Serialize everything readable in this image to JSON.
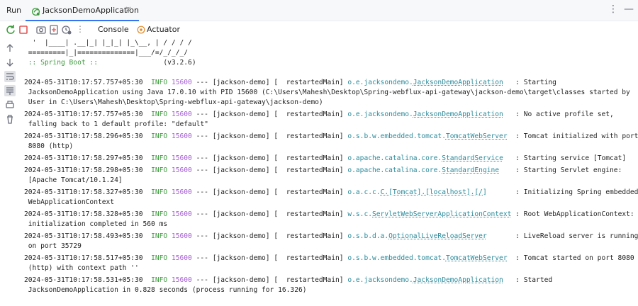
{
  "topbar": {
    "run_label": "Run",
    "tab_label": "JacksonDemoApplication",
    "close": "×",
    "more": "⋮",
    "minimize": "—"
  },
  "toolbar": {
    "separator": "⋮",
    "console_label": "Console",
    "actuator_label": "Actuator"
  },
  "console": {
    "banner_line1": "  '  |____| .__|_| |_|_| |_\\__, | / / / /",
    "banner_line2": " =========|_|==============|___/=/_/_/_/",
    "spring_boot_label": " :: Spring Boot ::",
    "spring_boot_version": "                (v3.2.6)",
    "logs": [
      {
        "ts": "2024-05-31T10:17:57.757+05:30",
        "level": "INFO",
        "pid": "15600",
        "thread": " --- [jackson-demo] [  restartedMain] ",
        "logger_pre": "o.e.jacksondemo.",
        "logger_ul": "JacksonDemoApplication",
        "msg": "   : Starting",
        "cont": [
          " JacksonDemoApplication using Java 17.0.10 with PID 15600 (C:\\Users\\Mahesh\\Desktop\\Spring-webflux-api-gateway\\jackson-demo\\target\\classes started by",
          " User in C:\\Users\\Mahesh\\Desktop\\Spring-webflux-api-gateway\\jackson-demo)"
        ]
      },
      {
        "ts": "2024-05-31T10:17:57.757+05:30",
        "level": "INFO",
        "pid": "15600",
        "thread": " --- [jackson-demo] [  restartedMain] ",
        "logger_pre": "o.e.jacksondemo.",
        "logger_ul": "JacksonDemoApplication",
        "msg": "   : No active profile set,",
        "cont": [
          " falling back to 1 default profile: \"default\""
        ]
      },
      {
        "ts": "2024-05-31T10:17:58.296+05:30",
        "level": "INFO",
        "pid": "15600",
        "thread": " --- [jackson-demo] [  restartedMain] ",
        "logger_pre": "o.s.b.w.embedded.tomcat.",
        "logger_ul": "TomcatWebServer",
        "msg": "  : Tomcat initialized with port",
        "cont": [
          " 8080 (http)"
        ]
      },
      {
        "ts": "2024-05-31T10:17:58.297+05:30",
        "level": "INFO",
        "pid": "15600",
        "thread": " --- [jackson-demo] [  restartedMain] ",
        "logger_pre": "o.apache.catalina.core.",
        "logger_ul": "StandardService",
        "msg": "   : Starting service [Tomcat]",
        "cont": []
      },
      {
        "ts": "2024-05-31T10:17:58.298+05:30",
        "level": "INFO",
        "pid": "15600",
        "thread": " --- [jackson-demo] [  restartedMain] ",
        "logger_pre": "o.apache.catalina.core.",
        "logger_ul": "StandardEngine",
        "msg": "    : Starting Servlet engine:",
        "cont": [
          " [Apache Tomcat/10.1.24]"
        ]
      },
      {
        "ts": "2024-05-31T10:17:58.327+05:30",
        "level": "INFO",
        "pid": "15600",
        "thread": " --- [jackson-demo] [  restartedMain] ",
        "logger_pre": "o.a.c.c.",
        "logger_ul": "C.[Tomcat].[localhost].[/]",
        "msg": "       : Initializing Spring embedded",
        "cont": [
          " WebApplicationContext"
        ]
      },
      {
        "ts": "2024-05-31T10:17:58.328+05:30",
        "level": "INFO",
        "pid": "15600",
        "thread": " --- [jackson-demo] [  restartedMain] ",
        "logger_pre": "w.s.c.",
        "logger_ul": "ServletWebServerApplicationContext",
        "msg": " : Root WebApplicationContext:",
        "cont": [
          " initialization completed in 560 ms"
        ]
      },
      {
        "ts": "2024-05-31T10:17:58.493+05:30",
        "level": "INFO",
        "pid": "15600",
        "thread": " --- [jackson-demo] [  restartedMain] ",
        "logger_pre": "o.s.b.d.a.",
        "logger_ul": "OptionalLiveReloadServer",
        "msg": "       : LiveReload server is running",
        "cont": [
          " on port 35729"
        ]
      },
      {
        "ts": "2024-05-31T10:17:58.517+05:30",
        "level": "INFO",
        "pid": "15600",
        "thread": " --- [jackson-demo] [  restartedMain] ",
        "logger_pre": "o.s.b.w.embedded.tomcat.",
        "logger_ul": "TomcatWebServer",
        "msg": "  : Tomcat started on port 8080",
        "cont": [
          " (http) with context path ''"
        ]
      },
      {
        "ts": "2024-05-31T10:17:58.531+05:30",
        "level": "INFO",
        "pid": "15600",
        "thread": " --- [jackson-demo] [  restartedMain] ",
        "logger_pre": "o.e.jacksondemo.",
        "logger_ul": "JacksonDemoApplication",
        "msg": "   : Started",
        "cont": [
          " JacksonDemoApplication in 0.828 seconds (process running for 16.326)"
        ]
      }
    ]
  },
  "colors": {
    "info": "#3c9b3c",
    "pid": "#a65bd6",
    "logger": "#2b8a9b",
    "tab_underline": "#3574f0"
  }
}
